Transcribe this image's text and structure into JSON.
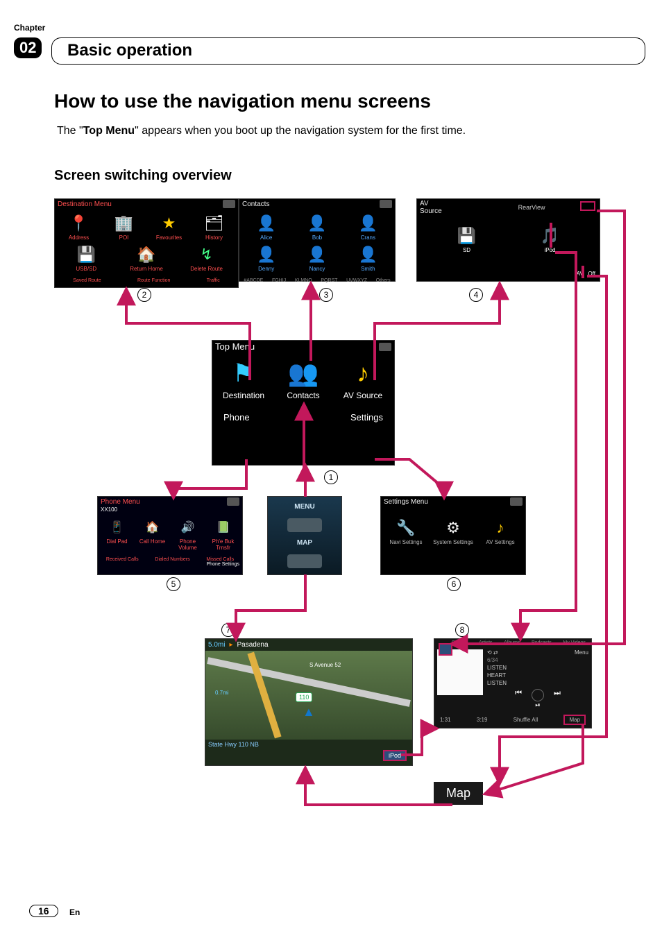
{
  "header": {
    "chapter_label": "Chapter",
    "chapter_number": "02",
    "chapter_title": "Basic operation"
  },
  "section": {
    "title": "How to use the navigation menu screens",
    "intro_prefix": "The \"",
    "intro_bold": "Top Menu",
    "intro_suffix": "\" appears when you boot up the navigation system for the first time.",
    "sub_title": "Screen switching overview"
  },
  "callouts": {
    "c1": "1",
    "c2": "2",
    "c3": "3",
    "c4": "4",
    "c5": "5",
    "c6": "6",
    "c7": "7",
    "c8": "8"
  },
  "top_menu": {
    "title": "Top Menu",
    "items": [
      "Destination",
      "Contacts",
      "AV Source"
    ],
    "bottom": [
      "Phone",
      "Settings"
    ]
  },
  "dest_menu": {
    "title": "Destination Menu",
    "row1": [
      "Address",
      "POI",
      "Favourites"
    ],
    "row2": [
      "History",
      "USB/SD",
      "Return Home",
      "Delete Route"
    ],
    "strip": [
      "Saved Route",
      "Route Function",
      "",
      "Traffic"
    ]
  },
  "contacts": {
    "title": "Contacts",
    "row1": [
      "Alice",
      "Bob",
      "Crans"
    ],
    "row2": [
      "Denny",
      "Nancy",
      "Smith"
    ],
    "strip": [
      "#ABCDE",
      "FGHIJ",
      "KLMNO",
      "PQRST",
      "UVWXYZ",
      "Others"
    ]
  },
  "av_source": {
    "title": "AV Source",
    "rear": "RearView",
    "items": [
      "SD",
      "iPod"
    ],
    "av_off_left": "AV",
    "av_off_right": "Off"
  },
  "phone_menu": {
    "title": "Phone Menu",
    "device": "XX100",
    "row1": [
      "Dial Pad",
      "Call Home",
      "Phone Volume",
      "Ph'e Buk Trnsfr"
    ],
    "row2": [
      "Received Calls",
      "Dialed Numbers",
      "Missed Calls"
    ],
    "settings": "Phone Settings"
  },
  "mid_strip": {
    "menu": "MENU",
    "map": "MAP"
  },
  "settings_menu": {
    "title": "Settings Menu",
    "items": [
      "Navi Settings",
      "System Settings",
      "AV Settings"
    ]
  },
  "map_screen": {
    "distance": "5.0mi",
    "destination": "Pasadena",
    "street": "S Avenue 52",
    "hwy": "110",
    "sub_dist": "0.7mi",
    "status": "State Hwy 110 NB",
    "ipod": "iPod"
  },
  "media": {
    "tabs": [
      "",
      "Genres",
      "Artists",
      "Albums",
      "Podcasts",
      "My Videos"
    ],
    "loop": "⟲ ⇄",
    "menu": "Menu",
    "track": "6/34",
    "lines": [
      "LISTEN",
      "HEART",
      "LISTEN"
    ],
    "pos": "1:31",
    "dur": "3:19",
    "shuffle": "Shuffle All",
    "map": "Map",
    "prev": "⏮",
    "play": "⏯",
    "next": "⏭"
  },
  "map_label": "Map",
  "footer": {
    "page": "16",
    "lang": "En"
  }
}
